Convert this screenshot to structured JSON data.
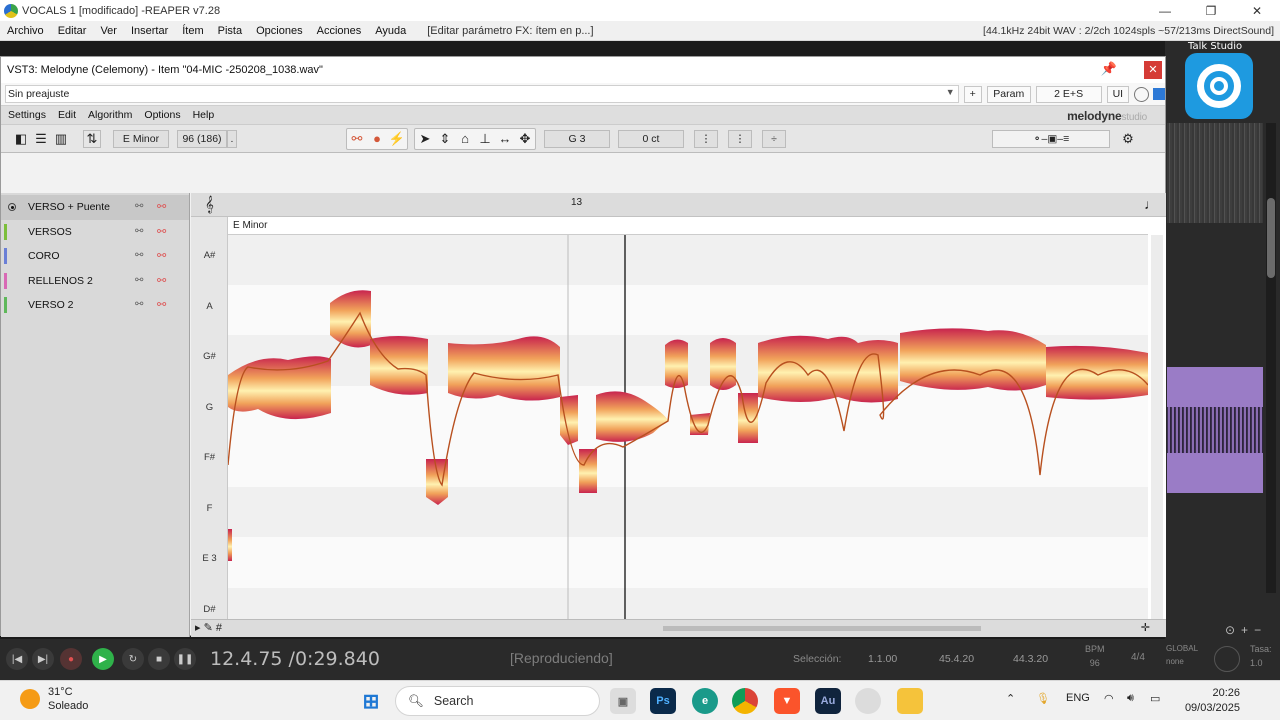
{
  "reaper": {
    "window_title": "VOCALS 1 [modificado] -REAPER v7.28",
    "menus": [
      "Archivo",
      "Editar",
      "Ver",
      "Insertar",
      "Ítem",
      "Pista",
      "Opciones",
      "Acciones",
      "Ayuda"
    ],
    "fx_param": "[Editar parámetro FX: ítem en p...]",
    "audio_status": "[44.1kHz 24bit WAV : 2/2ch 1024spls ~57/213ms DirectSound]",
    "talk_studio": "Talk Studio"
  },
  "plugin": {
    "title": "VST3: Melodyne (Celemony) - Item \"04-MIC -250208_1038.wav\"",
    "preset": "Sin preajuste",
    "plus_label": "+",
    "param_label": "Param",
    "io_label": "2 E+S",
    "ui_label": "UI"
  },
  "melodyne": {
    "menus": [
      "Settings",
      "Edit",
      "Algorithm",
      "Options",
      "Help"
    ],
    "logo": "melodyne",
    "logo_edition": "studio",
    "key_label": "E Minor",
    "tempo_label": "96 (186)",
    "pitch_readout": "G 3",
    "cents_readout": "0 ct",
    "bar_number": "13",
    "scale_label": "E Minor",
    "tracks": [
      {
        "label": "VERSO + Puente",
        "color": "#bdbdbd",
        "selected": true
      },
      {
        "label": "VERSOS",
        "color": "#7cbf3b",
        "selected": false
      },
      {
        "label": "CORO",
        "color": "#6a7fd6",
        "selected": false
      },
      {
        "label": "RELLENOS 2",
        "color": "#d869b5",
        "selected": false
      },
      {
        "label": "VERSO 2",
        "color": "#5fb85a",
        "selected": false
      }
    ],
    "note_names": [
      "A#",
      "A",
      "G#",
      "G",
      "F#",
      "F",
      "E 3",
      "D#"
    ]
  },
  "transport": {
    "time": "12.4.75 /0:29.840",
    "status": "[Reproduciendo]",
    "selection_label": "Selección:",
    "sel_start": "1.1.00",
    "sel_end": "45.4.20",
    "sel_length": "44.3.20",
    "bpm_label": "BPM",
    "bpm_value": "96",
    "time_sig": "4/4",
    "global_label": "GLOBAL",
    "global_value": "none",
    "rate_label": "Tasa:",
    "rate_value": "1.0"
  },
  "taskbar": {
    "temp": "31°C",
    "weather": "Soleado",
    "search": "Search",
    "lang": "ENG",
    "time": "20:26",
    "date": "09/03/2025"
  },
  "colors": {
    "blob_outer": "#c8244e",
    "blob_inner": "#fff1b0",
    "pitch_line": "#b8501f"
  }
}
